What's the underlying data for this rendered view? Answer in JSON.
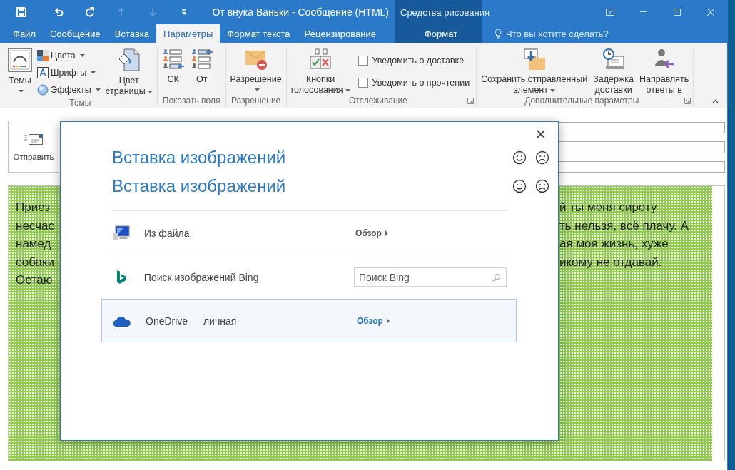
{
  "window": {
    "title": "От внука Ваньки - Сообщение (HTML)",
    "context_group": "Средства рисования"
  },
  "quick_access": [
    {
      "kind": "save",
      "disabled": false
    },
    {
      "kind": "undo",
      "disabled": false
    },
    {
      "kind": "redo",
      "disabled": false
    },
    {
      "kind": "up",
      "disabled": true
    },
    {
      "kind": "down",
      "disabled": true
    },
    {
      "kind": "customize",
      "disabled": false
    }
  ],
  "tabs": [
    {
      "label": "Файл",
      "selected": false,
      "contextual": false
    },
    {
      "label": "Сообщение",
      "selected": false,
      "contextual": false
    },
    {
      "label": "Вставка",
      "selected": false,
      "contextual": false
    },
    {
      "label": "Параметры",
      "selected": true,
      "contextual": false
    },
    {
      "label": "Формат текста",
      "selected": false,
      "contextual": false
    },
    {
      "label": "Рецензирование",
      "selected": false,
      "contextual": false
    },
    {
      "label": "Формат",
      "selected": false,
      "contextual": true
    }
  ],
  "tell_me": {
    "placeholder": "Что вы хотите сделать?"
  },
  "ribbon_groups": [
    {
      "label": "Темы",
      "launcher": false,
      "items": [
        {
          "kind": "large",
          "lines": [
            "Темы"
          ],
          "dropdown": true
        },
        {
          "kind": "stack",
          "items": [
            {
              "kind": "small",
              "label": "Цвета",
              "dropdown": true
            },
            {
              "kind": "small",
              "label": "Шрифты",
              "dropdown": true
            },
            {
              "kind": "small",
              "label": "Эффекты",
              "dropdown": true
            }
          ]
        },
        {
          "kind": "large",
          "lines": [
            "Цвет",
            "страницы"
          ],
          "dropdown": true
        }
      ]
    },
    {
      "label": "Показать поля",
      "launcher": false,
      "items": [
        {
          "kind": "large",
          "lines": [
            "СК"
          ],
          "dropdown": false
        },
        {
          "kind": "large",
          "lines": [
            "От"
          ],
          "dropdown": false
        }
      ]
    },
    {
      "label": "Разрешение",
      "launcher": false,
      "items": [
        {
          "kind": "large",
          "lines": [
            "Разрешение"
          ],
          "dropdown": true
        }
      ]
    },
    {
      "label": "Отслеживание",
      "launcher": true,
      "items": [
        {
          "kind": "large",
          "lines": [
            "Кнопки",
            "голосования"
          ],
          "dropdown": true
        },
        {
          "kind": "stack",
          "items": [
            {
              "kind": "check",
              "label": "Уведомить о доставке",
              "checked": false
            },
            {
              "kind": "check",
              "label": "Уведомить о прочтении",
              "checked": false
            }
          ]
        }
      ]
    },
    {
      "label": "Дополнительные параметры",
      "launcher": true,
      "items": [
        {
          "kind": "large",
          "lines": [
            "Сохранить отправленный",
            "элемент"
          ],
          "dropdown": true
        },
        {
          "kind": "large",
          "lines": [
            "Задержка",
            "доставки"
          ],
          "dropdown": false
        },
        {
          "kind": "large",
          "lines": [
            "Направлять",
            "ответы в"
          ],
          "dropdown": false
        }
      ]
    }
  ],
  "compose": {
    "send_button": "Отправить",
    "body_left": [
      "Приез",
      "несчас",
      "намед",
      "собаки",
      "Остаю"
    ],
    "body_right": [
      "й ты меня сироту",
      "ть нельзя, всё плачу. А",
      "ая моя жизнь, хуже",
      "икому не отдавай."
    ]
  },
  "dialog": {
    "titles": [
      "Вставка изображений",
      "Вставка изображений"
    ],
    "sources": [
      {
        "kind": "browse",
        "label": "Из файла",
        "action": "Обзор",
        "selected": false
      },
      {
        "kind": "search",
        "label": "Поиск изображений Bing",
        "placeholder": "Поиск Bing",
        "selected": false
      },
      {
        "kind": "browse",
        "label": "OneDrive — личная",
        "action": "Обзор",
        "selected": true
      }
    ]
  }
}
